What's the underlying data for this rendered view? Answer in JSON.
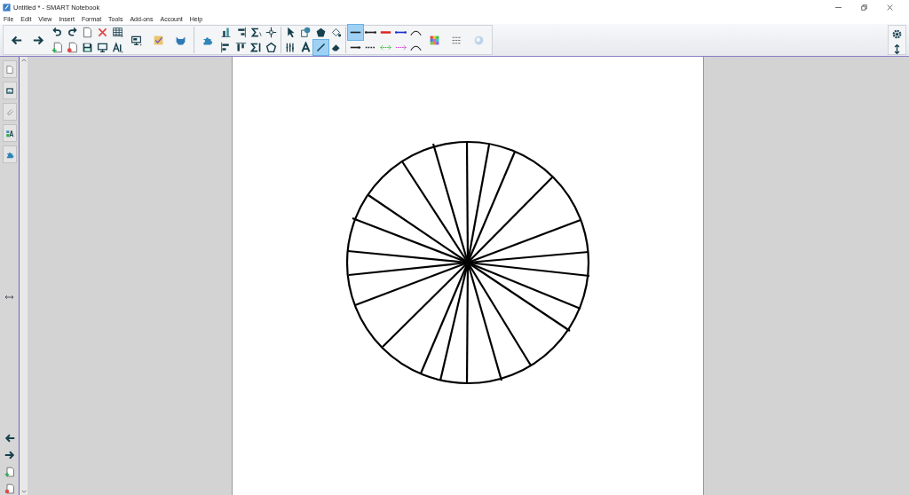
{
  "window": {
    "title": "Untitled * - SMART Notebook"
  },
  "menu": [
    "File",
    "Edit",
    "View",
    "Insert",
    "Format",
    "Tools",
    "Add-ons",
    "Account",
    "Help"
  ],
  "toolbar": [
    {
      "kind": "large",
      "tools": [
        {
          "kind": "back",
          "selected": false
        },
        {
          "kind": "forward",
          "selected": false
        }
      ]
    },
    {
      "kind": "grid",
      "tools": [
        {
          "kind": "undo",
          "selected": false
        },
        {
          "kind": "redo",
          "selected": false
        },
        {
          "kind": "page",
          "selected": false
        },
        {
          "kind": "delete",
          "selected": false
        },
        {
          "kind": "table",
          "selected": false
        },
        {
          "kind": "add-page",
          "selected": false
        },
        {
          "kind": "remove-page",
          "selected": false
        },
        {
          "kind": "save",
          "selected": false
        },
        {
          "kind": "screen",
          "selected": false
        },
        {
          "kind": "font",
          "selected": false
        }
      ]
    },
    {
      "kind": "large",
      "tools": [
        {
          "kind": "shade"
        },
        {
          "kind": "check"
        },
        {
          "kind": "cat"
        }
      ]
    },
    {
      "kind": "sep"
    },
    {
      "kind": "large",
      "tools": [
        {
          "kind": "puzzle",
          "selected": false
        }
      ]
    },
    {
      "kind": "grid",
      "tools": [
        {
          "kind": "chart",
          "selected": false
        },
        {
          "kind": "align-right",
          "selected": false
        },
        {
          "kind": "sum",
          "selected": false
        },
        {
          "kind": "move",
          "selected": false
        },
        {
          "kind": "align-left",
          "selected": false
        },
        {
          "kind": "align-top",
          "selected": false
        },
        {
          "kind": "sum-col",
          "selected": false
        },
        {
          "kind": "pentagon",
          "selected": false
        }
      ]
    },
    {
      "kind": "sep"
    },
    {
      "kind": "grid",
      "tools": [
        {
          "kind": "select",
          "selected": false
        },
        {
          "kind": "shape",
          "selected": false
        },
        {
          "kind": "fill-shape",
          "selected": false
        },
        {
          "kind": "fill",
          "selected": false
        },
        {
          "kind": "pens",
          "selected": false
        },
        {
          "kind": "text",
          "selected": false
        },
        {
          "kind": "line",
          "selected": true
        },
        {
          "kind": "eraser",
          "selected": false
        }
      ]
    },
    {
      "kind": "sep"
    },
    {
      "kind": "grid",
      "tools": [
        {
          "kind": "ls-plain",
          "selected": true
        },
        {
          "kind": "ls-dots",
          "selected": false
        },
        {
          "kind": "ls-red",
          "selected": false
        },
        {
          "kind": "ls-blue",
          "selected": false
        },
        {
          "kind": "ls-arc",
          "selected": false
        },
        {
          "kind": "ls-arrow",
          "selected": false
        },
        {
          "kind": "ls-dash",
          "selected": false
        },
        {
          "kind": "ls-green",
          "selected": false
        },
        {
          "kind": "ls-pink",
          "selected": false
        },
        {
          "kind": "ls-arc",
          "selected": false
        }
      ]
    },
    {
      "kind": "large",
      "tools": [
        {
          "kind": "colors",
          "selected": false
        },
        {
          "kind": "line-options",
          "selected": false
        },
        {
          "kind": "effects",
          "selected": false
        }
      ]
    }
  ],
  "right_tools": [
    {
      "kind": "settings",
      "selected": false
    },
    {
      "kind": "move-toolbar",
      "selected": false
    }
  ],
  "side_tabs": [
    {
      "kind": "page",
      "selected": false
    },
    {
      "kind": "gallery",
      "selected": false
    },
    {
      "kind": "attach",
      "selected": false
    },
    {
      "kind": "properties",
      "selected": false
    },
    {
      "kind": "puzzle",
      "selected": false
    }
  ],
  "side_bottom": [
    {
      "kind": "back",
      "selected": false
    },
    {
      "kind": "forward",
      "selected": false
    },
    {
      "kind": "add-page",
      "selected": false
    },
    {
      "kind": "remove-page",
      "selected": false
    }
  ]
}
